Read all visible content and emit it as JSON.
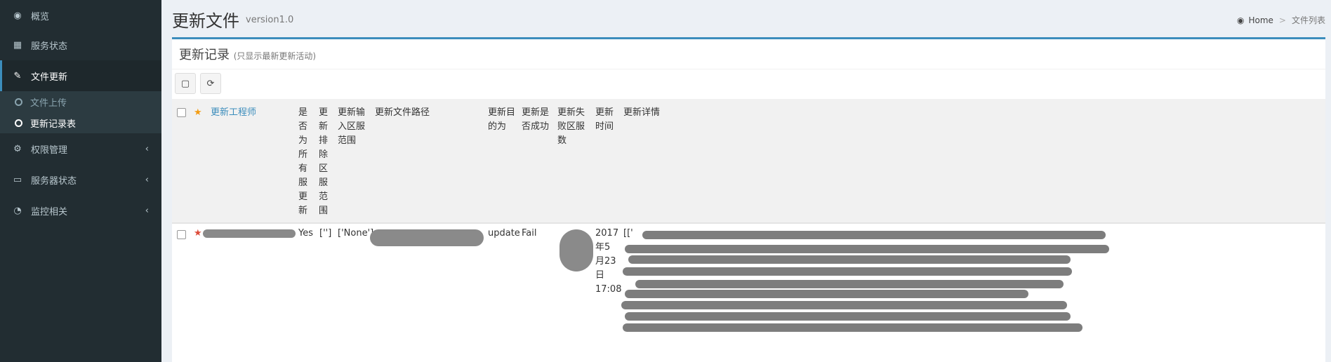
{
  "sidebar": {
    "items": [
      {
        "label": "概览",
        "icon": "dashboard-icon",
        "glyph": "◉"
      },
      {
        "label": "服务状态",
        "icon": "grid-icon",
        "glyph": "▦"
      },
      {
        "label": "文件更新",
        "icon": "edit-icon",
        "glyph": "✎"
      },
      {
        "label": "权限管理",
        "icon": "cogs-icon",
        "glyph": "⚙",
        "arrow": "‹"
      },
      {
        "label": "服务器状态",
        "icon": "laptop-icon",
        "glyph": "▭",
        "arrow": "‹"
      },
      {
        "label": "监控相关",
        "icon": "pie-chart-icon",
        "glyph": "◔",
        "arrow": "‹"
      }
    ],
    "submenu": [
      {
        "label": "文件上传"
      },
      {
        "label": "更新记录表"
      }
    ]
  },
  "header": {
    "title": "更新文件",
    "subtitle": "version1.0",
    "breadcrumb": {
      "home": "Home",
      "separator": ">",
      "current": "文件列表"
    }
  },
  "box": {
    "title": "更新记录",
    "note": "(只显示最新更新活动)",
    "toolbar": {
      "toggle_glyph": "▢",
      "refresh_glyph": "⟳"
    }
  },
  "table": {
    "headers": {
      "star": "★",
      "engineer": "更新工程师",
      "all_servers": "是\n否\n为\n所\n有\n服\n更\n新",
      "exclude_range": "更\n新\n排\n除\n区\n服\n范\n围",
      "input_range": "更新输\n入区服\n范围",
      "file_path": "更新文件路径",
      "purpose": "更新目\n的为",
      "success": "更新是\n否成功",
      "fail_count": "更新失\n败区服\n数",
      "time": "更新\n时间",
      "detail": "更新详情"
    },
    "rows": [
      {
        "star": "★",
        "all_servers": "Yes",
        "exclude_range": "['']",
        "input_range": "['None']",
        "purpose": "update",
        "success": "Fail",
        "time": "2017\n年5\n月23\n日\n17:08",
        "detail_prefix": "[['"
      }
    ]
  },
  "colors": {
    "sidebar_bg": "#222d32",
    "accent": "#3c8dbc",
    "star_header": "#f39c12",
    "star_row": "#dd4b39"
  }
}
